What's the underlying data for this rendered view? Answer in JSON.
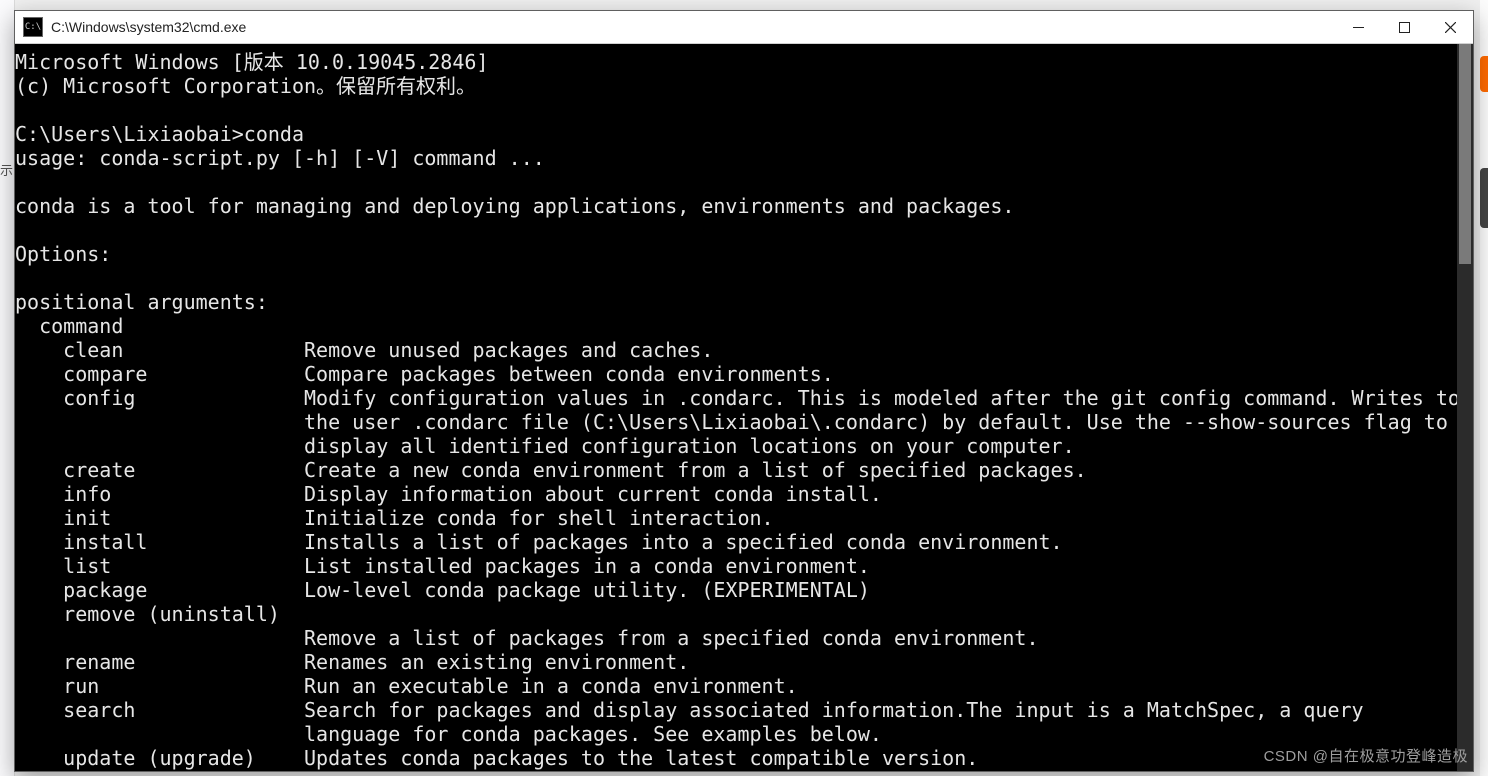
{
  "window": {
    "title": "C:\\Windows\\system32\\cmd.exe",
    "icon_label": "C:\\"
  },
  "term": {
    "header1": "Microsoft Windows [版本 10.0.19045.2846]",
    "header2": "(c) Microsoft Corporation。保留所有权利。",
    "prompt": "C:\\Users\\Lixiaobai>",
    "command": "conda",
    "usage": "usage: conda-script.py [-h] [-V] command ...",
    "desc": "conda is a tool for managing and deploying applications, environments and packages.",
    "options_hdr": "Options:",
    "posarg_hdr": "positional arguments:",
    "command_hdr": "  command",
    "commands": [
      {
        "name": "clean",
        "desc": "Remove unused packages and caches."
      },
      {
        "name": "compare",
        "desc": "Compare packages between conda environments."
      },
      {
        "name": "config",
        "desc": "Modify configuration values in .condarc. This is modeled after the git config command. Writes to"
      },
      {
        "name": "",
        "desc": "the user .condarc file (C:\\Users\\Lixiaobai\\.condarc) by default. Use the --show-sources flag to"
      },
      {
        "name": "",
        "desc": "display all identified configuration locations on your computer."
      },
      {
        "name": "create",
        "desc": "Create a new conda environment from a list of specified packages."
      },
      {
        "name": "info",
        "desc": "Display information about current conda install."
      },
      {
        "name": "init",
        "desc": "Initialize conda for shell interaction."
      },
      {
        "name": "install",
        "desc": "Installs a list of packages into a specified conda environment."
      },
      {
        "name": "list",
        "desc": "List installed packages in a conda environment."
      },
      {
        "name": "package",
        "desc": "Low-level conda package utility. (EXPERIMENTAL)"
      },
      {
        "name": "remove (uninstall)",
        "desc": ""
      },
      {
        "name": "",
        "desc": "Remove a list of packages from a specified conda environment."
      },
      {
        "name": "rename",
        "desc": "Renames an existing environment."
      },
      {
        "name": "run",
        "desc": "Run an executable in a conda environment."
      },
      {
        "name": "search",
        "desc": "Search for packages and display associated information.The input is a MatchSpec, a query"
      },
      {
        "name": "",
        "desc": "language for conda packages. See examples below."
      },
      {
        "name": "update (upgrade)",
        "desc": "Updates conda packages to the latest compatible version."
      }
    ]
  },
  "watermark": "CSDN @自在极意功登峰造极",
  "left_chars": "示"
}
